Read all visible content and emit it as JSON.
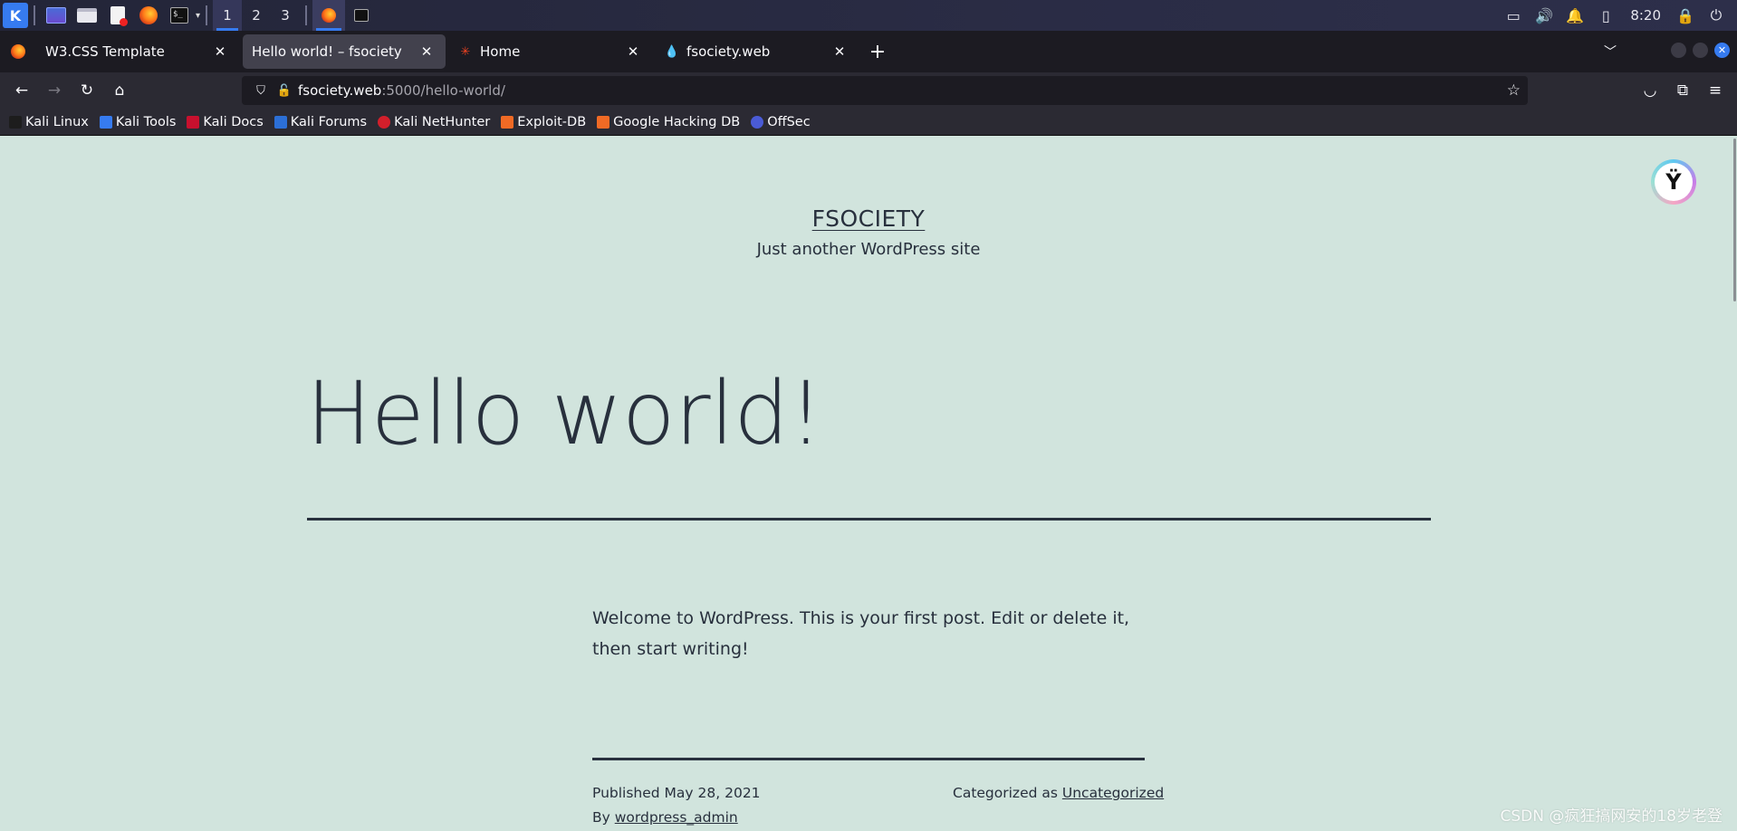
{
  "taskbar": {
    "workspaces": [
      "1",
      "2",
      "3"
    ],
    "clock": "8:20",
    "terminal_glyph": "$_",
    "kali_glyph": "K"
  },
  "tabs": [
    {
      "title": "W3.CSS Template",
      "icon": "generic-page-icon"
    },
    {
      "title": "Hello world! – fsociety",
      "icon": "none"
    },
    {
      "title": "Home",
      "icon": "joomla-icon"
    },
    {
      "title": "fsociety.web",
      "icon": "drupal-icon"
    }
  ],
  "urlbar": {
    "host": "fsociety.web",
    "path": ":5000/hello-world/"
  },
  "bookmarks": [
    {
      "label": "Kali Linux",
      "color": "#1d1d1d"
    },
    {
      "label": "Kali Tools",
      "color": "#367bf0"
    },
    {
      "label": "Kali Docs",
      "color": "#c8102e"
    },
    {
      "label": "Kali Forums",
      "color": "#2c6fd6"
    },
    {
      "label": "Kali NetHunter",
      "color": "#d21f2b"
    },
    {
      "label": "Exploit-DB",
      "color": "#f06a25"
    },
    {
      "label": "Google Hacking DB",
      "color": "#f06a25"
    },
    {
      "label": "OffSec",
      "color": "#4a5bd6"
    }
  ],
  "page": {
    "site_title": "FSOCIETY",
    "site_description": "Just another WordPress site",
    "post_title": "Hello world!",
    "post_body": "Welcome to WordPress. This is your first post. Edit or delete it, then start writing!",
    "published_label": "Published May 28, 2021",
    "categorized_prefix": "Categorized as ",
    "category": "Uncategorized",
    "by_prefix": "By ",
    "author": "wordpress_admin",
    "background": "#d1e4dd",
    "text_color": "#28303d"
  },
  "watermark": "CSDN @疯狂搞网安的18岁老登"
}
